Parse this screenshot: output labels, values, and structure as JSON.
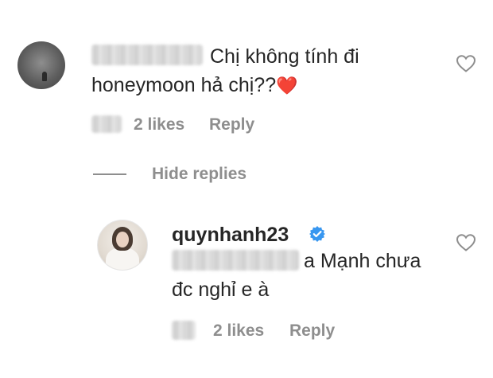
{
  "comment": {
    "text_line1": "Chị không tính đi",
    "text_line2": "honeymoon hả chị??",
    "heart": "❤️",
    "likes": "2 likes",
    "reply": "Reply"
  },
  "replies_toggle": {
    "label": "Hide replies"
  },
  "reply_comment": {
    "username": "quynhanh23",
    "text_line1": "a Mạnh chưa",
    "text_line2": "đc nghỉ e à",
    "likes": "2 likes",
    "reply": "Reply"
  },
  "icons": {
    "like": "heart-outline-icon",
    "verified": "verified-badge-icon",
    "emoji": "red-heart-emoji"
  },
  "colors": {
    "text": "#262626",
    "meta": "#8e8e8e",
    "verified": "#3897f0",
    "heart": "#d70a2c"
  }
}
